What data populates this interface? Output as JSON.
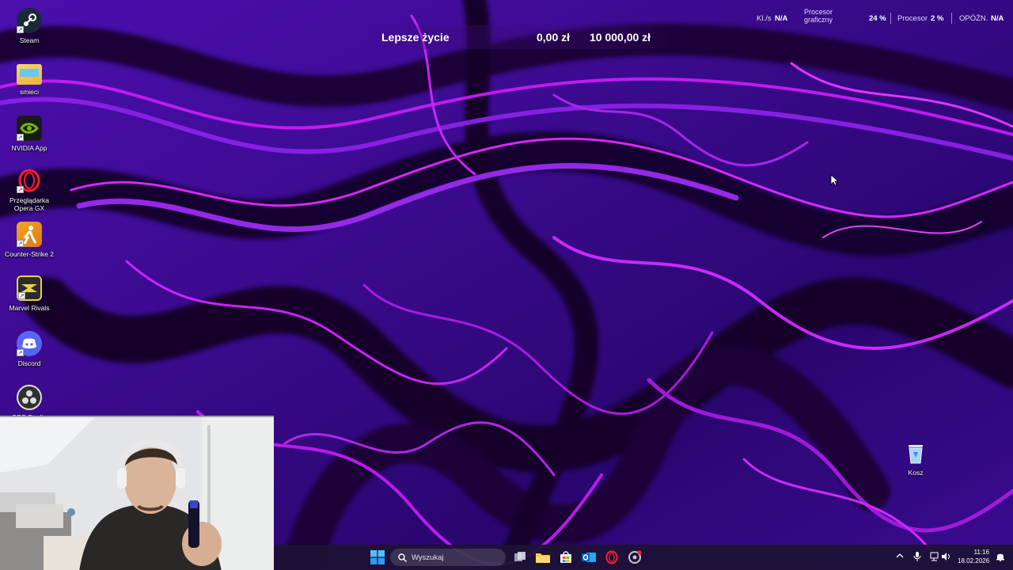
{
  "desktop_icons": [
    {
      "label": "Steam",
      "icon": "steam-icon",
      "color": "#1b2838"
    },
    {
      "label": "smieci",
      "icon": "folder-icon",
      "color": "#f2c94c"
    },
    {
      "label": "NVIDIA App",
      "icon": "nvidia-icon",
      "color": "#76b900"
    },
    {
      "label": "Przeglądarka Opera GX",
      "icon": "opera-gx-icon",
      "color": "#ff1b2d"
    },
    {
      "label": "Counter-Strike 2",
      "icon": "counter-strike-icon",
      "color": "#f5a623"
    },
    {
      "label": "Marvel Rivals",
      "icon": "marvel-rivals-icon",
      "color": "#e8d24a"
    },
    {
      "label": "Discord",
      "icon": "discord-icon",
      "color": "#5865f2"
    },
    {
      "label": "OBS Studio",
      "icon": "obs-icon",
      "color": "#302e31"
    }
  ],
  "recycle_bin": {
    "label": "Kosz",
    "icon": "recycle-bin-icon"
  },
  "money_widget": {
    "title": "Lepsze życie",
    "current": "0,00 zł",
    "goal": "10 000,00 zł"
  },
  "stats": {
    "fps_label": "Kl./s",
    "fps_value": "N/A",
    "gpu_label_1": "Procesor",
    "gpu_label_2": "graficzny",
    "gpu_value": "24 %",
    "cpu_label": "Procesor",
    "cpu_value": "2 %",
    "latency_label": "OPÓŹN.",
    "latency_value": "N/A"
  },
  "taskbar": {
    "search_placeholder": "Wyszukaj",
    "apps": [
      "start-icon",
      "task-view-icon",
      "file-explorer-icon",
      "store-icon",
      "outlook-icon",
      "opera-gx-icon",
      "chrome-like-icon"
    ],
    "clock_time": "11:16",
    "clock_date": "18.02.2026"
  },
  "colors": {
    "wallpaper_dark": "#1a0038",
    "wallpaper_mid": "#5a12c8",
    "wallpaper_bright": "#d020ff",
    "taskbar": "#1c1234"
  }
}
